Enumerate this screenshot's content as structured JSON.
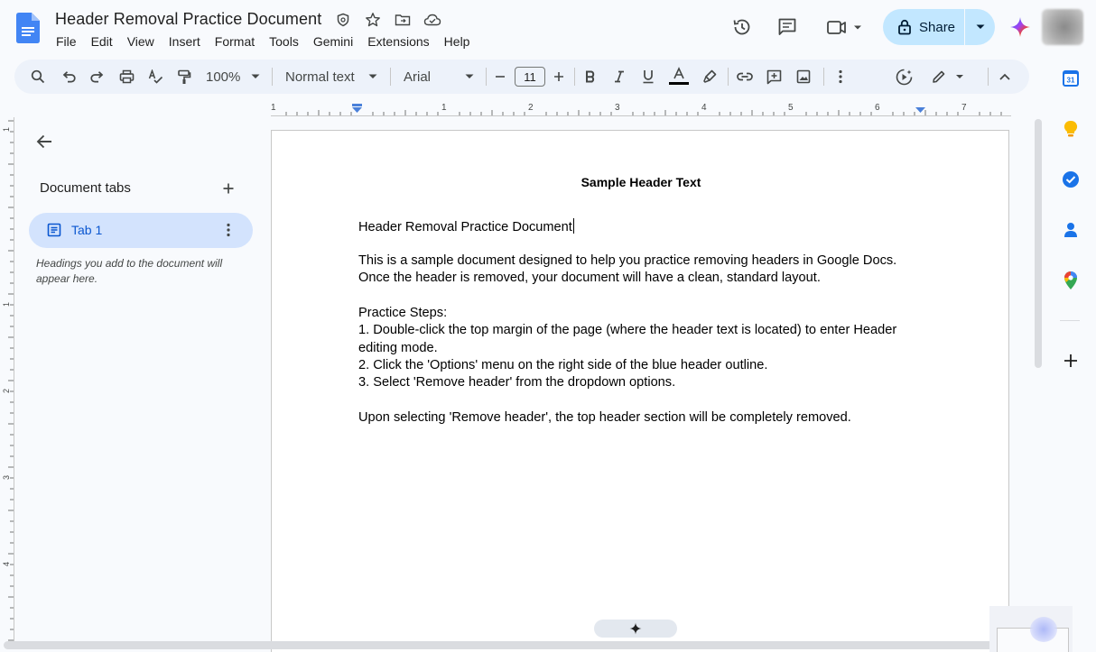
{
  "document": {
    "title": "Header Removal Practice Document"
  },
  "menu": {
    "items": [
      "File",
      "Edit",
      "View",
      "Insert",
      "Format",
      "Tools",
      "Gemini",
      "Extensions",
      "Help"
    ]
  },
  "share": {
    "label": "Share"
  },
  "toolbar": {
    "zoom": "100%",
    "style": "Normal text",
    "font": "Arial",
    "font_size": "11"
  },
  "ruler": {
    "labels": [
      "1",
      "1",
      "2",
      "3",
      "4",
      "5",
      "6",
      "7"
    ]
  },
  "sidebar": {
    "section_title": "Document tabs",
    "tab_label": "Tab 1",
    "hint": "Headings you add to the document will appear here."
  },
  "page": {
    "header_text": "Sample Header Text",
    "lines": [
      "Header Removal Practice Document",
      "This is a sample document designed to help you practice removing headers in Google Docs.",
      "Once the header is removed, your document will have a clean, standard layout.",
      "Practice Steps:",
      "1. Double-click the top margin of the page (where the header text is located) to enter Header",
      "editing mode.",
      "2. Click the 'Options' menu on the right side of the blue header outline.",
      "3. Select 'Remove header' from the dropdown options.",
      "Upon selecting 'Remove header', the top header section will be completely removed."
    ]
  },
  "colors": {
    "accent": "#0b57d0",
    "share_bg": "#c2e7ff",
    "tab_bg": "#d3e3fd",
    "toolbar_bg": "#edf2fa",
    "app_bg": "#f8fafd"
  },
  "icons": {
    "header": [
      "docs-logo",
      "security-icon",
      "star-icon",
      "move-folder-icon",
      "cloud-saved-icon",
      "history-icon",
      "comments-icon",
      "meet-icon",
      "lock-icon",
      "gemini-icon"
    ],
    "side_panel": [
      "calendar-icon",
      "keep-icon",
      "tasks-icon",
      "contacts-icon",
      "maps-icon",
      "add-icon"
    ]
  }
}
